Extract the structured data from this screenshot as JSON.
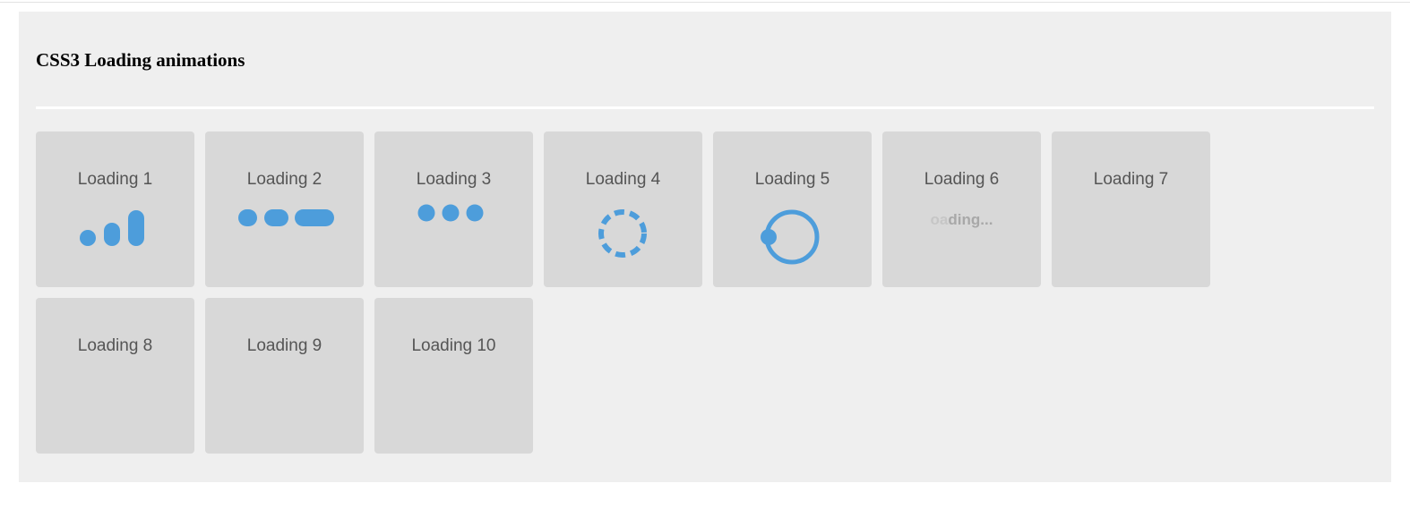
{
  "page": {
    "title": "CSS3 Loading animations"
  },
  "colors": {
    "accent": "#4d9ddb",
    "card_bg": "#d8d8d8",
    "panel_bg": "#efefef"
  },
  "cards": [
    {
      "label": "Loading 1",
      "animation": "growing-bars"
    },
    {
      "label": "Loading 2",
      "animation": "stretching-dots"
    },
    {
      "label": "Loading 3",
      "animation": "three-dots"
    },
    {
      "label": "Loading 4",
      "animation": "dashed-ring"
    },
    {
      "label": "Loading 5",
      "animation": "orbit-ring"
    },
    {
      "label": "Loading 6",
      "animation": "fading-text",
      "text_dim": "oa",
      "text_mid": "ding..."
    },
    {
      "label": "Loading 7",
      "animation": "none-visible"
    },
    {
      "label": "Loading 8",
      "animation": "none-visible"
    },
    {
      "label": "Loading 9",
      "animation": "none-visible"
    },
    {
      "label": "Loading 10",
      "animation": "none-visible"
    }
  ]
}
